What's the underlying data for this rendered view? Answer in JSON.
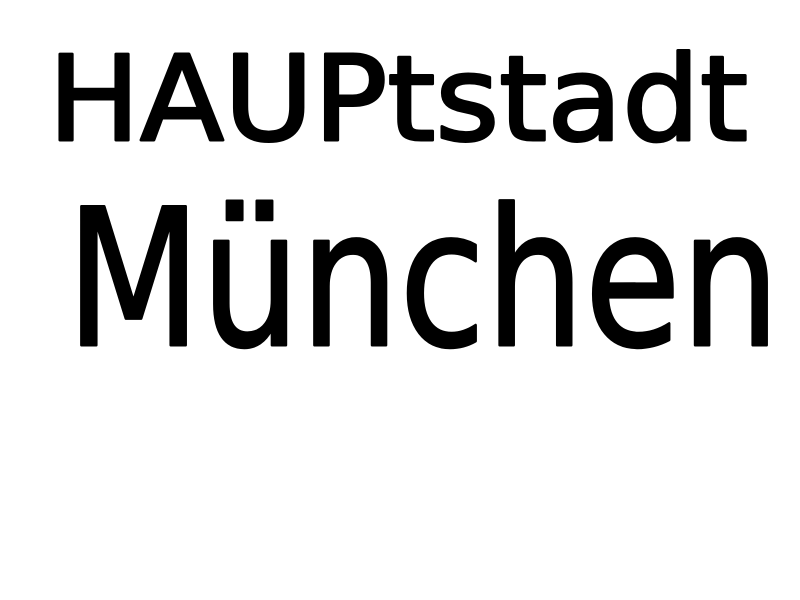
{
  "drawing": {
    "line1": "HAUPtstadt",
    "line2": "München",
    "ink_color": "#000000",
    "background_color": "#ffffff"
  }
}
